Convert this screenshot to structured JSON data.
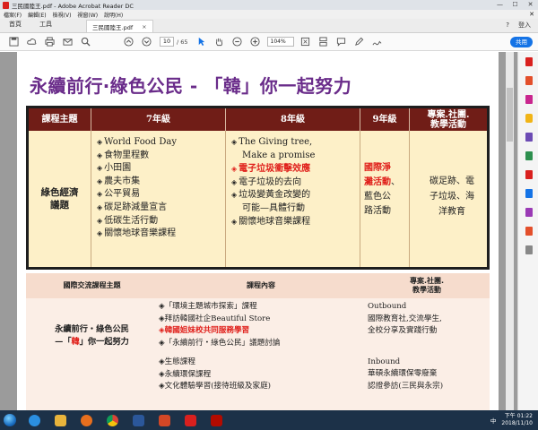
{
  "window": {
    "title": "三民國陸王.pdf - Adobe Acrobat Reader DC",
    "minimize": "—",
    "maximize": "☐",
    "close": "✕"
  },
  "menu": {
    "items": [
      "檔案(F)",
      "編輯(E)",
      "檢視(V)",
      "視窗(W)",
      "說明(H)"
    ],
    "close": "✕"
  },
  "tabs": {
    "home": "首頁",
    "tools": "工具",
    "document": "三民國陸王.pdf",
    "document_close": "×",
    "help": "?",
    "login": "登入"
  },
  "toolbar": {
    "page_current": "10",
    "page_total": "/ 65",
    "zoom": "104%",
    "share": "共用"
  },
  "slide": {
    "title": "永續前行‧綠色公民 - 「韓」你一起努力",
    "table1": {
      "headers": [
        "課程主題",
        "7年級",
        "8年級",
        "9年級",
        "專案.社團.\n教學活動"
      ],
      "theme": [
        "綠色經濟",
        "議題"
      ],
      "grade7": [
        "World Food Day",
        "食物里程數",
        "小田園",
        "農夫市集",
        "公平貿易",
        "碳足跡減量宣言",
        "低碳生活行動",
        "關懷地球音樂課程"
      ],
      "grade8": [
        {
          "text": "The Giving tree,",
          "bullet": true,
          "red": false
        },
        {
          "text": "Make a promise",
          "bullet": false,
          "red": false
        },
        {
          "text": "電子垃圾衝擊效應",
          "bullet": true,
          "red": true
        },
        {
          "text": "電子垃圾的去向",
          "bullet": true,
          "red": false
        },
        {
          "text": "垃圾變黃金改變的",
          "bullet": true,
          "red": false
        },
        {
          "text": "可能—具體行動",
          "bullet": false,
          "red": false
        },
        {
          "text": "關懷地球音樂課程",
          "bullet": true,
          "red": false
        }
      ],
      "grade9_red": [
        "國際淨",
        "灘活動"
      ],
      "grade9_rest": [
        "、",
        "藍色公",
        "路活動"
      ],
      "club": [
        "碳足跡、電",
        "子垃圾、海",
        "洋教育"
      ]
    },
    "table2": {
      "headers": [
        "國際交流課程主題",
        "課程內容",
        "專案.社團.\n教學活動"
      ],
      "theme_line1": "永續前行‧綠色公民",
      "theme_line2_pre": "—「",
      "theme_line2_red": "韓",
      "theme_line2_post": "」你一起努力",
      "content": [
        {
          "text": "「環境主題城市探索」課程",
          "bullet": true,
          "red": false,
          "gap": false
        },
        {
          "text": "拜訪韓國社企Beautiful Store",
          "bullet": true,
          "red": false,
          "gap": false
        },
        {
          "text": "韓國姐妹校共同服務學習",
          "bullet": true,
          "red": true,
          "gap": false
        },
        {
          "text": "「永續前行‧綠色公民」議題討論",
          "bullet": true,
          "red": false,
          "gap": false
        },
        {
          "text": "生態課程",
          "bullet": true,
          "red": false,
          "gap": true
        },
        {
          "text": "永續環保課程",
          "bullet": true,
          "red": false,
          "gap": false
        },
        {
          "text": "文化體驗學習(接待班級及家庭)",
          "bullet": true,
          "red": false,
          "gap": false
        }
      ],
      "activities_top": [
        "Outbound",
        "國際教育社,交流學生,",
        "全校分享及實踐行動"
      ],
      "activities_bottom": [
        "Inbound",
        "華碩永續環保零廢棄",
        "認證參訪(三民與永宗)"
      ]
    }
  },
  "taskbar": {
    "ime": "中",
    "time": "下午 01:22",
    "date": "2018/11/10"
  },
  "colors": {
    "title_purple": "#6a2c8a",
    "header_maroon": "#701d17",
    "table_cream": "#fdf0c8",
    "highlight_red": "#e0201b",
    "share_blue": "#1473e6"
  }
}
